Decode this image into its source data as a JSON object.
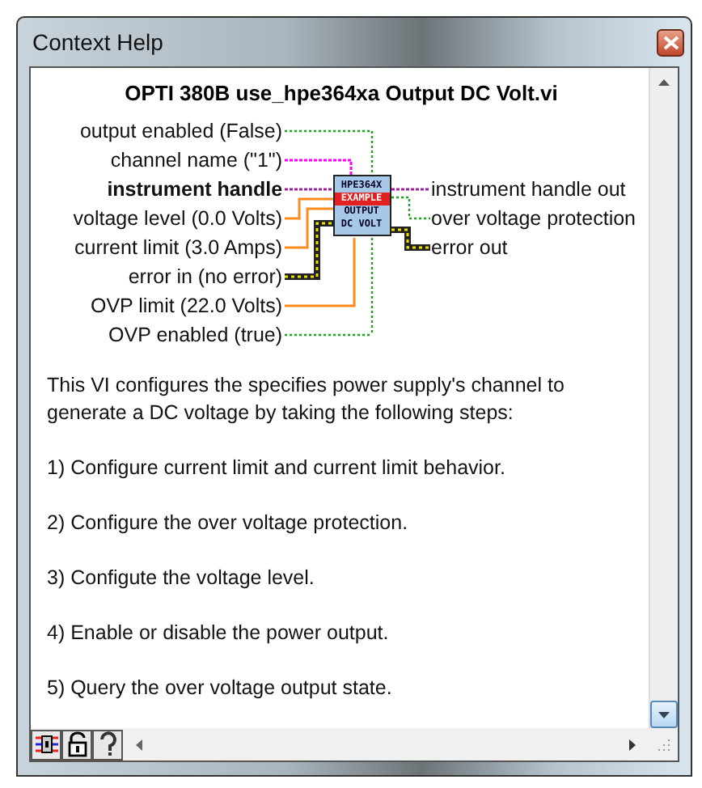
{
  "window": {
    "title": "Context Help"
  },
  "vi_title": "OPTI 380B use_hpe364xa Output DC Volt.vi",
  "connector_pane": {
    "icon_lines": [
      {
        "text": "HPE364X",
        "kind": "plain"
      },
      {
        "text": "EXAMPLE",
        "kind": "banner"
      },
      {
        "text": "OUTPUT",
        "kind": "plain"
      },
      {
        "text": "DC VOLT",
        "kind": "plain"
      }
    ],
    "inputs": [
      {
        "label": "output enabled (False)",
        "kind": "boolean",
        "required": false
      },
      {
        "label": "channel name (\"1\")",
        "kind": "string",
        "required": false
      },
      {
        "label": "instrument handle",
        "kind": "refnum",
        "required": true
      },
      {
        "label": "voltage level (0.0 Volts)",
        "kind": "numeric",
        "required": false
      },
      {
        "label": "current limit (3.0 Amps)",
        "kind": "numeric",
        "required": false
      },
      {
        "label": "error in (no error)",
        "kind": "error",
        "required": false
      },
      {
        "label": "OVP limit (22.0 Volts)",
        "kind": "numeric",
        "required": false
      },
      {
        "label": "OVP enabled (true)",
        "kind": "boolean",
        "required": false
      }
    ],
    "outputs": [
      {
        "label": "instrument handle out",
        "kind": "refnum"
      },
      {
        "label": "over voltage protection",
        "kind": "boolean"
      },
      {
        "label": "error out",
        "kind": "error"
      }
    ]
  },
  "description": [
    "This VI configures the specifies power supply's channel to generate a DC voltage by taking the following steps:",
    "1) Configure current limit and current limit behavior.",
    "2) Configure the over voltage protection.",
    "3) Configute the voltage level.",
    "4) Enable or disable the power output.",
    "5) Query the over voltage output state."
  ]
}
